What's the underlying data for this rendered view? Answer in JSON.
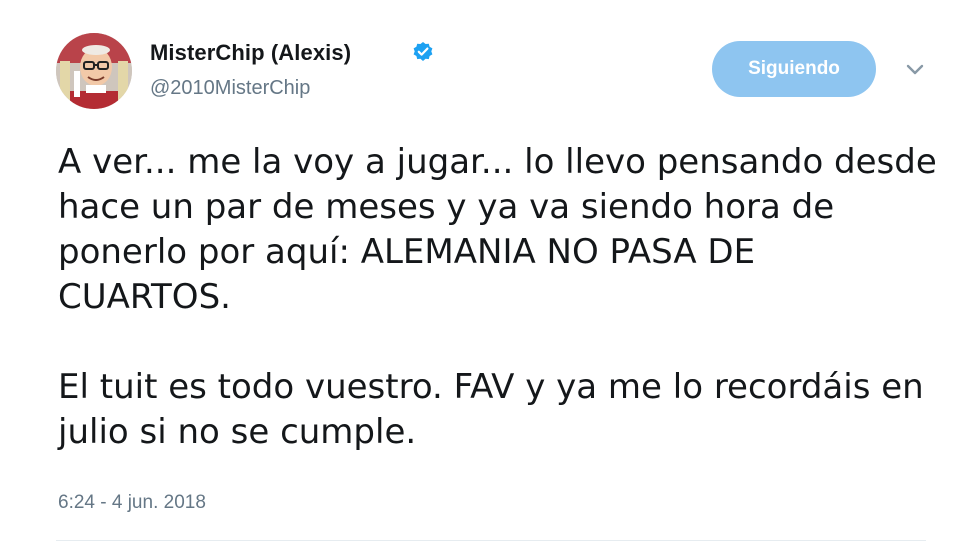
{
  "user": {
    "display_name": "MisterChip (Alexis)",
    "handle": "@2010MisterChip",
    "verified": true,
    "avatar_icon": "profile-avatar"
  },
  "actions": {
    "follow_label": "Siguiendo",
    "more_icon": "chevron-down-icon"
  },
  "tweet": {
    "paragraph_1": "A ver... me la voy a jugar... lo llevo pensando desde hace un par de meses y ya va siendo hora de ponerlo por aquí: ALEMANIA NO PASA DE CUARTOS.",
    "paragraph_2": "El tuit es todo vuestro. FAV y ya me lo recordáis en julio si no se cumple.",
    "timestamp": "6:24 - 4 jun. 2018"
  },
  "colors": {
    "follow_button": "#8ec5f0",
    "verified_badge": "#1da1f2",
    "secondary_text": "#657786"
  }
}
